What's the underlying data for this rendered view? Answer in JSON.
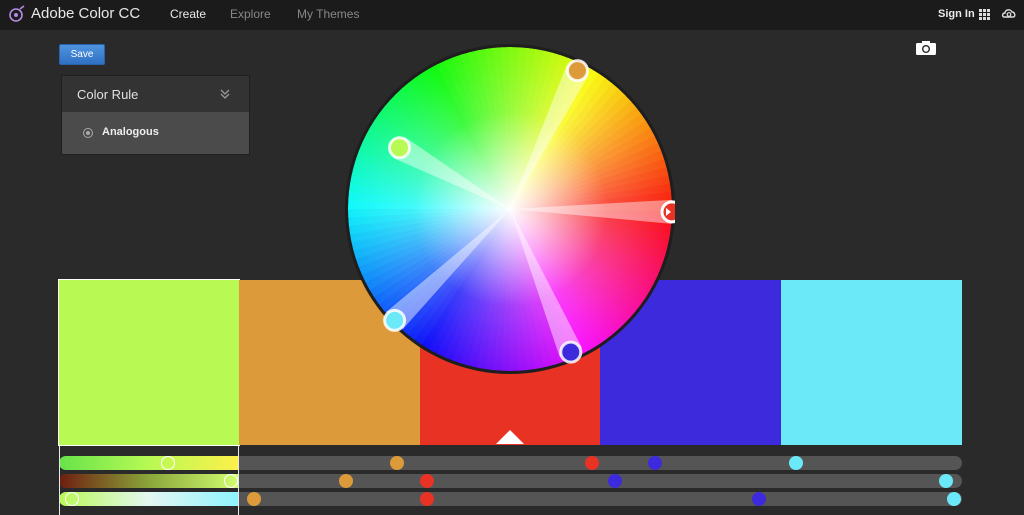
{
  "app": {
    "title": "Adobe Color CC"
  },
  "nav": {
    "items": [
      {
        "label": "Create",
        "active": true
      },
      {
        "label": "Explore",
        "active": false
      },
      {
        "label": "My Themes",
        "active": false
      }
    ],
    "sign_in": "Sign In"
  },
  "toolbar": {
    "save_label": "Save"
  },
  "color_rule": {
    "title": "Color Rule",
    "selected": "Analogous"
  },
  "theme": {
    "selected_index": 2,
    "swatches": [
      {
        "hex": "#B8F954"
      },
      {
        "hex": "#DD9A3A"
      },
      {
        "hex": "#E83224"
      },
      {
        "hex": "#3D2ADD"
      },
      {
        "hex": "#6CE9F9"
      }
    ]
  },
  "icons": {
    "logo": "adobe-color-logo-icon",
    "apps": "apps-grid-icon",
    "cc": "creative-cloud-icon",
    "camera": "camera-icon",
    "collapse": "chevron-double-down-icon",
    "radio": "radio-selected-icon"
  }
}
